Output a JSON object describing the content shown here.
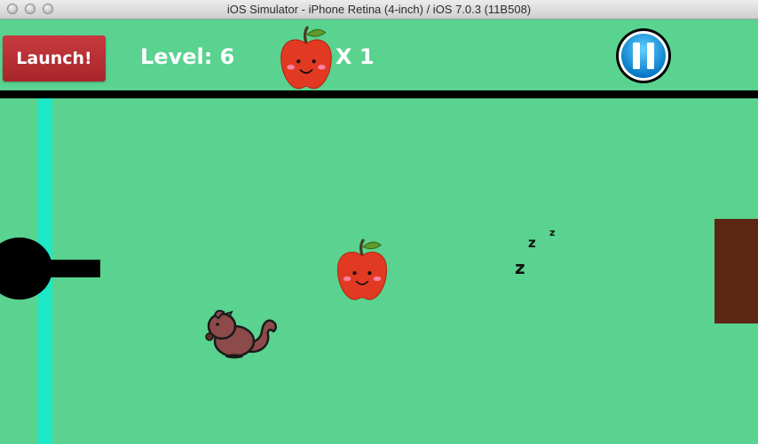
{
  "window": {
    "title": "iOS Simulator - iPhone Retina (4-inch) / iOS 7.0.3 (11B508)"
  },
  "hud": {
    "launch_label": "Launch!",
    "level_text": "Level: 6",
    "apple_count_text": "X 1"
  },
  "sleep_indicator": {
    "letters": [
      "z",
      "z",
      "z"
    ]
  },
  "colors": {
    "background": "#59d38f",
    "launch_button": "#b93036",
    "pause_button": "#0a8bd6",
    "strip": "#1de8c7",
    "wall": "#5c2613",
    "apple": "#e23a22",
    "squirrel": "#8c4a4a"
  },
  "icons": [
    "apple-icon",
    "pause-icon",
    "squirrel",
    "cannon"
  ]
}
